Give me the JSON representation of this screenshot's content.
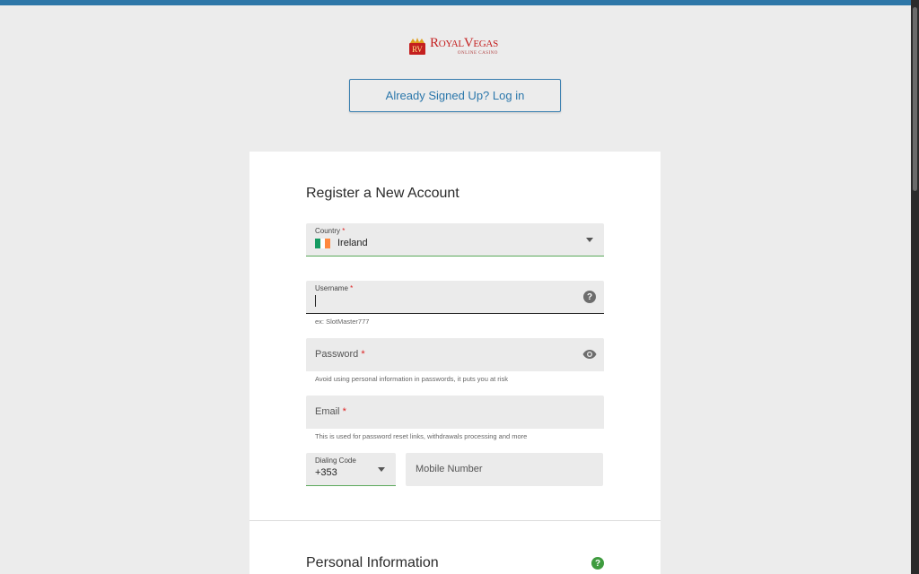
{
  "brand": {
    "logo_name": "RoyalVegas",
    "logo_sub": "ONLINE CASINO",
    "logo_monogram": "RV",
    "accent": "#2e77a8",
    "brand_red": "#c41f1f"
  },
  "header": {
    "login_label": "Already Signed Up? Log in"
  },
  "form": {
    "title": "Register a New Account",
    "country": {
      "label": "Country",
      "required_mark": "*",
      "value": "Ireland",
      "flag_colors": [
        "#169b62",
        "#ffffff",
        "#ff883e"
      ]
    },
    "username": {
      "label": "Username",
      "required_mark": "*",
      "value": "",
      "hint": "ex: SlotMaster777",
      "icon": "help-icon"
    },
    "password": {
      "label": "Password",
      "required_mark": "*",
      "hint": "Avoid using personal information in passwords, it puts you at risk",
      "icon": "eye-icon"
    },
    "email": {
      "label": "Email",
      "required_mark": "*",
      "hint": "This is used for password reset links, withdrawals processing and more"
    },
    "dialing_code": {
      "label": "Dialing Code",
      "value": "+353"
    },
    "mobile": {
      "placeholder": "Mobile Number"
    }
  },
  "personal_section": {
    "title": "Personal Information",
    "help_icon": "help-icon",
    "help_color": "#3f9b3f"
  }
}
